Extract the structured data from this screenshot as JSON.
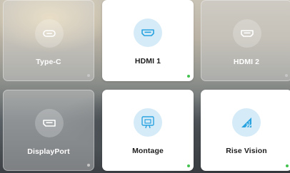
{
  "sources": [
    {
      "label": "Type-C",
      "icon": "usb-c-port-icon",
      "active": false,
      "connected": false
    },
    {
      "label": "HDMI 1",
      "icon": "hdmi-port-icon",
      "active": true,
      "connected": true
    },
    {
      "label": "HDMI 2",
      "icon": "hdmi-port-icon",
      "active": false,
      "connected": false
    },
    {
      "label": "DisplayPort",
      "icon": "displayport-icon",
      "active": false,
      "connected": false
    },
    {
      "label": "Montage",
      "icon": "montage-icon",
      "active": true,
      "connected": true
    },
    {
      "label": "Rise Vision",
      "icon": "rise-vision-icon",
      "active": true,
      "connected": true
    }
  ],
  "colors": {
    "accent": "#29a3e0",
    "icon_bg_active": "#d6ebf8",
    "connected_dot": "#43c24f",
    "disconnected_dot": "#c6c6c6"
  }
}
